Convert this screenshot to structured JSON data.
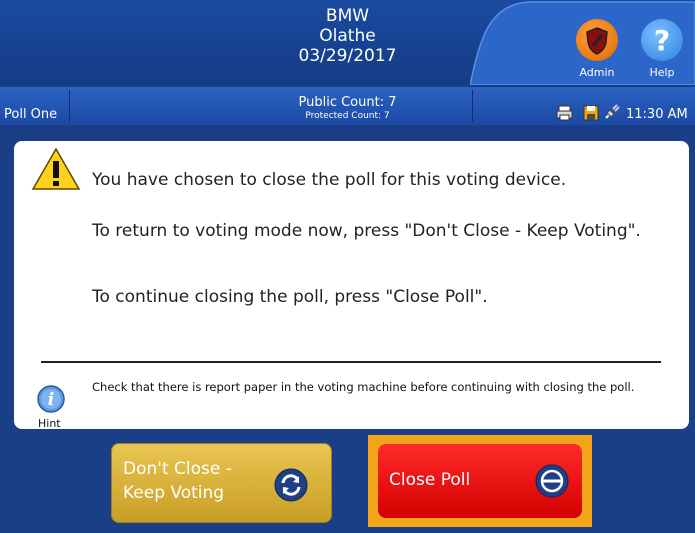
{
  "header": {
    "line1": "BMW",
    "line2": "Olathe",
    "line3": "03/29/2017",
    "admin_label": "Admin",
    "help_label": "Help"
  },
  "statusbar": {
    "poll_name": "Poll One",
    "public_count": "Public Count: 7",
    "protected_count": "Protected Count: 7",
    "time": "11:30 AM"
  },
  "dialog": {
    "message_1": "You have chosen to close the poll for this voting device.",
    "message_2": "To return to voting mode now, press \"Don't Close - Keep Voting\".",
    "message_3": "To continue closing the poll, press \"Close Poll\".",
    "hint_text": "Check that there is report paper in the voting machine before continuing with closing the poll.",
    "hint_label": "Hint"
  },
  "buttons": {
    "dont_close_label": "Don't Close - Keep Voting",
    "close_poll_label": "Close Poll"
  },
  "colors": {
    "background": "#1b3f86",
    "admin_orange": "#f07a12",
    "dont_close_gold": "#d9b13b",
    "close_red": "#e00000",
    "selection_frame": "#f2a41a"
  },
  "icons": [
    "shield-icon",
    "help-icon",
    "printer-icon",
    "save-icon",
    "power-plug-icon",
    "warning-icon",
    "info-icon",
    "refresh-icon",
    "stop-circle-icon"
  ]
}
